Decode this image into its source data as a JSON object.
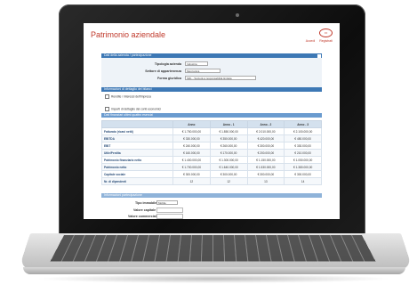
{
  "app": {
    "title": "Patrimonio aziendale",
    "brand": "▭",
    "links": [
      "Accedi",
      "Registrati"
    ]
  },
  "section1": {
    "header": "Dati della azienda / partecipazione",
    "fields": [
      {
        "label": "Tipologia azienda",
        "value": "Industria"
      },
      {
        "label": "Settore di appartenenza",
        "value": "Meccanica"
      },
      {
        "label": "Forma giuridica",
        "value": "SRL - Società a responsabilità limitata"
      }
    ]
  },
  "section2": {
    "header": "Informazioni di dettaglio dei bilanci",
    "checkbox1": "Rendite / interessi dell'impresa",
    "checkbox2": "Importi di dettaglio dei conti economici"
  },
  "table": {
    "header": "Dati finanziari ultimi quattro esercizi",
    "columns": [
      "",
      "Anno",
      "Anno - 1",
      "Anno - 2",
      "Anno - 3"
    ],
    "rows": [
      {
        "label": "Fatturato (ricavi netti)",
        "values": [
          "€ 1.750.000,00",
          "€ 1.850.000,00",
          "€ 2.010.000,00",
          "€ 2.100.000,00"
        ]
      },
      {
        "label": "EBITDA",
        "values": [
          "€ 330.000,00",
          "€ 350.000,00",
          "€ 420.000,00",
          "€ 450.000,00"
        ]
      },
      {
        "label": "EBIT",
        "values": [
          "€ 240.000,00",
          "€ 260.000,00",
          "€ 300.000,00",
          "€ 330.000,00"
        ]
      },
      {
        "label": "Utile/Perdita",
        "values": [
          "€ 160.000,00",
          "€ 170.000,00",
          "€ 200.000,00",
          "€ 210.000,00"
        ]
      },
      {
        "label": "Patrimonio finanziario netto",
        "values": [
          "€ 1.400.000,00",
          "€ 1.300.000,00",
          "€ 1.150.000,00",
          "€ 1.050.000,00"
        ]
      },
      {
        "label": "Patrimonio netto",
        "values": [
          "€ 1.700.000,00",
          "€ 1.640.000,00",
          "€ 1.530.000,00",
          "€ 1.380.000,00"
        ]
      },
      {
        "label": "Capitale sociale",
        "values": [
          "€ 300.000,00",
          "€ 300.000,00",
          "€ 300.000,00",
          "€ 300.000,00"
        ]
      },
      {
        "label": "Nr. di dipendenti",
        "values": [
          "12",
          "12",
          "13",
          "14"
        ]
      }
    ]
  },
  "section3": {
    "header": "Informazioni partecipazione",
    "fields": [
      {
        "label": "Tipo immobile",
        "value": "Mobile"
      },
      {
        "label": "Valore capitale",
        "value": ""
      },
      {
        "label": "Valore commerciale",
        "value": ""
      }
    ]
  }
}
